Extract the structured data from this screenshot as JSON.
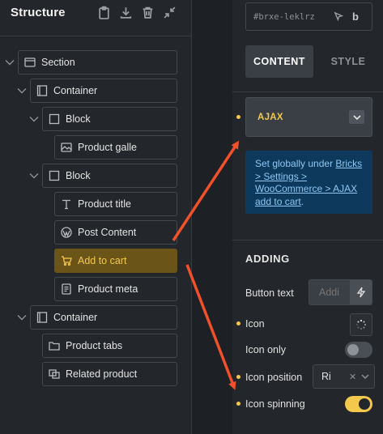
{
  "structure": {
    "title": "Structure",
    "tree": [
      {
        "label": "Section",
        "icon": "section-icon"
      },
      {
        "label": "Container",
        "icon": "container-icon"
      },
      {
        "label": "Block",
        "icon": "block-icon"
      },
      {
        "label": "Product galle",
        "icon": "image-icon"
      },
      {
        "label": "Block",
        "icon": "block-icon"
      },
      {
        "label": "Product title",
        "icon": "text-icon"
      },
      {
        "label": "Post Content",
        "icon": "wordpress-icon"
      },
      {
        "label": "Add to cart",
        "icon": "cart-icon"
      },
      {
        "label": "Product meta",
        "icon": "meta-icon"
      },
      {
        "label": "Container",
        "icon": "container-icon"
      },
      {
        "label": "Product tabs",
        "icon": "folder-icon"
      },
      {
        "label": "Related product",
        "icon": "related-icon"
      }
    ]
  },
  "element": {
    "id": "#brxe-leklrz"
  },
  "tabs": {
    "content": "CONTENT",
    "style": "STYLE"
  },
  "ajax": {
    "label": "AJAX"
  },
  "info": {
    "prefix": "Set globally under",
    "link": "Bricks > Settings > WooCommerce > AJAX add to cart",
    "suffix": "."
  },
  "adding": {
    "title": "ADDING",
    "button_text_label": "Button text",
    "button_text_placeholder": "Addi",
    "icon_label": "Icon",
    "icon_only_label": "Icon only",
    "icon_only_value": false,
    "icon_position_label": "Icon position",
    "icon_position_value": "Ri",
    "icon_spinning_label": "Icon spinning",
    "icon_spinning_value": true
  },
  "colors": {
    "accent": "#f2c94c",
    "active_bg": "#6b5418",
    "info_bg": "#0d3a5c",
    "info_text": "#8fc6f2",
    "arrow": "#f0502a"
  }
}
